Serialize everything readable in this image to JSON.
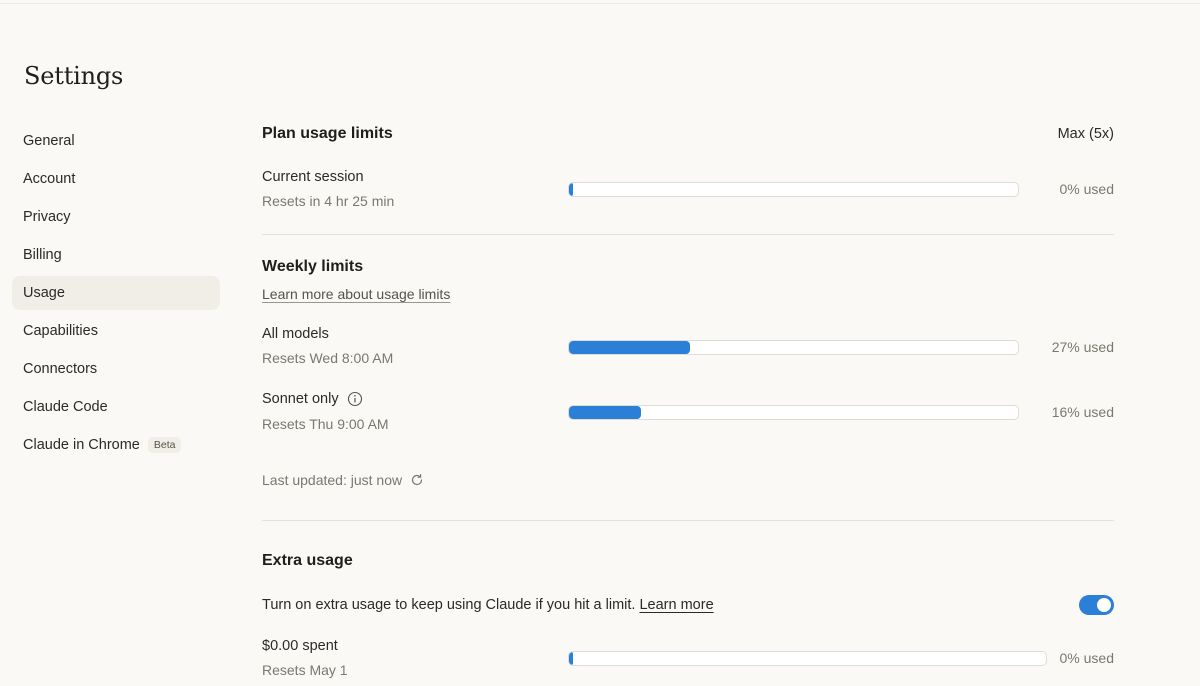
{
  "page": {
    "title": "Settings"
  },
  "sidebar": {
    "items": [
      {
        "label": "General"
      },
      {
        "label": "Account"
      },
      {
        "label": "Privacy"
      },
      {
        "label": "Billing"
      },
      {
        "label": "Usage",
        "active": true
      },
      {
        "label": "Capabilities"
      },
      {
        "label": "Connectors"
      },
      {
        "label": "Claude Code"
      },
      {
        "label": "Claude in Chrome",
        "badge": "Beta"
      }
    ]
  },
  "plan": {
    "title": "Plan usage limits",
    "plan_name": "Max (5x)",
    "current_session": {
      "label": "Current session",
      "resets": "Resets in 4 hr 25 min",
      "used_pct": 0,
      "used_text": "0% used"
    }
  },
  "weekly": {
    "title": "Weekly limits",
    "learn_more": "Learn more about usage limits",
    "all_models": {
      "label": "All models",
      "resets": "Resets Wed 8:00 AM",
      "used_pct": 27,
      "used_text": "27% used"
    },
    "sonnet": {
      "label": "Sonnet only",
      "icon": "info-icon",
      "resets": "Resets Thu 9:00 AM",
      "used_pct": 16,
      "used_text": "16% used"
    },
    "last_updated": "Last updated: just now"
  },
  "extra": {
    "title": "Extra usage",
    "description": "Turn on extra usage to keep using Claude if you hit a limit.",
    "learn_more": "Learn more",
    "toggle_on": true,
    "spent": {
      "label": "$0.00 spent",
      "resets": "Resets May 1",
      "used_pct": 0,
      "used_text": "0% used"
    }
  },
  "colors": {
    "accent": "#2c7fd6",
    "background": "#faf9f5",
    "active_item": "#f0eee6"
  }
}
